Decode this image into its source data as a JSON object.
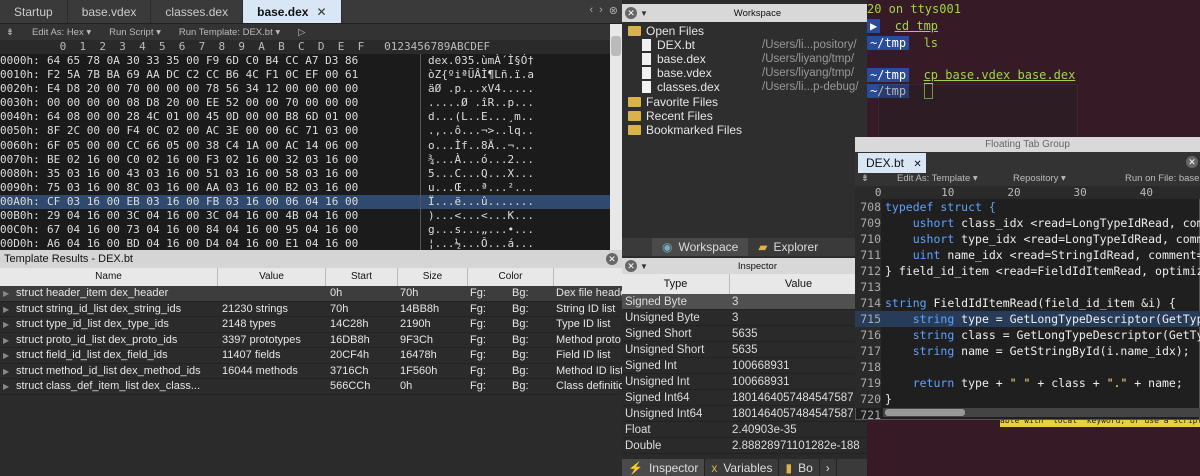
{
  "editor": {
    "tabs": [
      {
        "label": "Startup",
        "active": false
      },
      {
        "label": "base.vdex",
        "active": false
      },
      {
        "label": "classes.dex",
        "active": false
      },
      {
        "label": "base.dex",
        "active": true
      }
    ],
    "active_tab_close": "✕",
    "tab_nav": [
      "‹",
      "›",
      "⊗"
    ],
    "toolbar": {
      "edit_as": "Edit As: Hex ▾",
      "run_script": "Run Script ▾",
      "run_template": "Run Template: DEX.bt ▾",
      "play": "▷"
    },
    "hex_header": "         0  1  2  3  4  5  6  7  8  9  A  B  C  D  E  F   0123456789ABCDEF",
    "hex_rows": [
      {
        "off": "0000h:",
        "hex": "64 65 78 0A 30 33 35 00 F9 6D C0 B4 CC A7 D3 86",
        "asc": "dex.035.ùmÀ´Ì§Ó†"
      },
      {
        "off": "0010h:",
        "hex": "F2 5A 7B BA 69 AA DC C2 CC B6 4C F1 0C EF 00 61",
        "asc": "òZ{ºiªÜÂÌ¶Lñ.ï.a"
      },
      {
        "off": "0020h:",
        "hex": "E4 D8 20 00 70 00 00 00 78 56 34 12 00 00 00 00",
        "asc": "äØ .p...xV4....."
      },
      {
        "off": "0030h:",
        "hex": "00 00 00 00 08 D8 20 00 EE 52 00 00 70 00 00 00",
        "asc": ".....Ø .îR..p..."
      },
      {
        "off": "0040h:",
        "hex": "64 08 00 00 28 4C 01 00 45 0D 00 00 B8 6D 01 00",
        "asc": "d...(L..E...¸m.."
      },
      {
        "off": "0050h:",
        "hex": "8F 2C 00 00 F4 0C 02 00 AC 3E 00 00 6C 71 03 00",
        "asc": ".,..ô...¬>..lq.."
      },
      {
        "off": "0060h:",
        "hex": "6F 05 00 00 CC 66 05 00 38 C4 1A 00 AC 14 06 00",
        "asc": "o...Ìf..8Ä..¬..."
      },
      {
        "off": "0070h:",
        "hex": "BE 02 16 00 C0 02 16 00 F3 02 16 00 32 03 16 00",
        "asc": "¾...À...ó...2..."
      },
      {
        "off": "0080h:",
        "hex": "35 03 16 00 43 03 16 00 51 03 16 00 58 03 16 00",
        "asc": "5...C...Q...X..."
      },
      {
        "off": "0090h:",
        "hex": "75 03 16 00 8C 03 16 00 AA 03 16 00 B2 03 16 00",
        "asc": "u...Œ...ª...²..."
      },
      {
        "off": "00A0h:",
        "hex": "CF 03 16 00 EB 03 16 00 FB 03 16 00 06 04 16 00",
        "asc": "Ï...ë...û......."
      },
      {
        "off": "00B0h:",
        "hex": "29 04 16 00 3C 04 16 00 3C 04 16 00 4B 04 16 00",
        "asc": ")...<...<...K..."
      },
      {
        "off": "00C0h:",
        "hex": "67 04 16 00 73 04 16 00 84 04 16 00 95 04 16 00",
        "asc": "g...s...„...•..."
      },
      {
        "off": "00D0h:",
        "hex": "A6 04 16 00 BD 04 16 00 D4 04 16 00 E1 04 16 00",
        "asc": "¦...½...Ô...á..."
      }
    ],
    "selected_row": 10
  },
  "template": {
    "title": "Template Results - DEX.bt",
    "close": "✕",
    "columns": [
      "Name",
      "Value",
      "Start",
      "Size",
      "Color"
    ],
    "rows": [
      {
        "name": "struct header_item dex_header",
        "value": "",
        "start": "0h",
        "size": "70h",
        "fg": "Fg:",
        "bg": "Bg:",
        "comment": "Dex file header"
      },
      {
        "name": "struct string_id_list dex_string_ids",
        "value": "21230 strings",
        "start": "70h",
        "size": "14BB8h",
        "fg": "Fg:",
        "bg": "Bg:",
        "comment": "String ID list"
      },
      {
        "name": "struct type_id_list dex_type_ids",
        "value": "2148 types",
        "start": "14C28h",
        "size": "2190h",
        "fg": "Fg:",
        "bg": "Bg:",
        "comment": "Type ID list"
      },
      {
        "name": "struct proto_id_list dex_proto_ids",
        "value": "3397 prototypes",
        "start": "16DB8h",
        "size": "9F3Ch",
        "fg": "Fg:",
        "bg": "Bg:",
        "comment": "Method proto"
      },
      {
        "name": "struct field_id_list dex_field_ids",
        "value": "11407 fields",
        "start": "20CF4h",
        "size": "16478h",
        "fg": "Fg:",
        "bg": "Bg:",
        "comment": "Field ID list"
      },
      {
        "name": "struct method_id_list dex_method_ids",
        "value": "16044 methods",
        "start": "3716Ch",
        "size": "1F560h",
        "fg": "Fg:",
        "bg": "Bg:",
        "comment": "Method ID list"
      },
      {
        "name": "struct class_def_item_list dex_class...",
        "value": "",
        "start": "566CCh",
        "size": "0h",
        "fg": "Fg:",
        "bg": "Bg:",
        "comment": "Class definitions"
      }
    ]
  },
  "workspace": {
    "title": "Workspace",
    "open_files_label": "Open Files",
    "files": [
      {
        "name": "DEX.bt",
        "path": "/Users/li...pository/"
      },
      {
        "name": "base.dex",
        "path": "/Users/liyang/tmp/"
      },
      {
        "name": "base.vdex",
        "path": "/Users/liyang/tmp/"
      },
      {
        "name": "classes.dex",
        "path": "/Users/li...p-debug/"
      }
    ],
    "groups": [
      "Favorite Files",
      "Recent Files",
      "Bookmarked Files"
    ],
    "bottom_tabs": [
      "Workspace",
      "Explorer"
    ]
  },
  "inspector": {
    "title": "Inspector",
    "columns": [
      "Type",
      "Value"
    ],
    "rows": [
      {
        "type": "Signed Byte",
        "value": "3"
      },
      {
        "type": "Unsigned Byte",
        "value": "3"
      },
      {
        "type": "Signed Short",
        "value": "5635"
      },
      {
        "type": "Unsigned Short",
        "value": "5635"
      },
      {
        "type": "Signed Int",
        "value": "100668931"
      },
      {
        "type": "Unsigned Int",
        "value": "100668931"
      },
      {
        "type": "Signed Int64",
        "value": "1801464057484547587"
      },
      {
        "type": "Unsigned Int64",
        "value": "1801464057484547587"
      },
      {
        "type": "Float",
        "value": "2.40903e-35"
      },
      {
        "type": "Double",
        "value": "2.88828971101282e-188"
      }
    ],
    "bottom_tabs": [
      "Inspector",
      "Variables",
      "Bo"
    ]
  },
  "terminal": {
    "line1": "20 on ttys001",
    "cmd1": "cd tmp",
    "cmd2": "ls",
    "cmd3": "cp base.vdex base.dex",
    "prompt": "~/tmp",
    "warning": "able with 'local' keyword, or use a script instead."
  },
  "floating": {
    "title": "Floating Tab Group",
    "tab": "DEX.bt",
    "close": "✕",
    "toolbar": {
      "edit_as": "Edit As: Template ▾",
      "repository": "Repository ▾",
      "run_on": "Run on File: base"
    },
    "ruler": "   0         10        20        30        40",
    "code": [
      {
        "ln": "708",
        "text": "typedef struct {",
        "kind": "kw"
      },
      {
        "ln": "709",
        "text": "    ushort class_idx <read=LongTypeIdRead, comment",
        "kind": "plain"
      },
      {
        "ln": "710",
        "text": "    ushort type_idx <read=LongTypeIdRead, comment",
        "kind": "plain"
      },
      {
        "ln": "711",
        "text": "    uint name_idx <read=StringIdRead, comment=\"St",
        "kind": "plain"
      },
      {
        "ln": "712",
        "text": "} field_id_item <read=FieldIdItemRead, optimize=f",
        "kind": "plain"
      },
      {
        "ln": "713",
        "text": "",
        "kind": "plain"
      },
      {
        "ln": "714",
        "text": "string FieldIdItemRead(field_id_item &i) {",
        "kind": "plain"
      },
      {
        "ln": "715",
        "text": "    string type = GetLongTypeDescriptor(GetTypeBy",
        "kind": "plain"
      },
      {
        "ln": "716",
        "text": "    string class = GetLongTypeDescriptor(GetTypeB",
        "kind": "plain"
      },
      {
        "ln": "717",
        "text": "    string name = GetStringById(i.name_idx);",
        "kind": "plain"
      },
      {
        "ln": "718",
        "text": "",
        "kind": "plain"
      },
      {
        "ln": "719",
        "text": "    return type + \" \" + class + \".\" + name;",
        "kind": "plain"
      },
      {
        "ln": "720",
        "text": "}",
        "kind": "plain"
      },
      {
        "ln": "721",
        "text": "",
        "kind": "plain"
      }
    ],
    "current_line": 7
  }
}
